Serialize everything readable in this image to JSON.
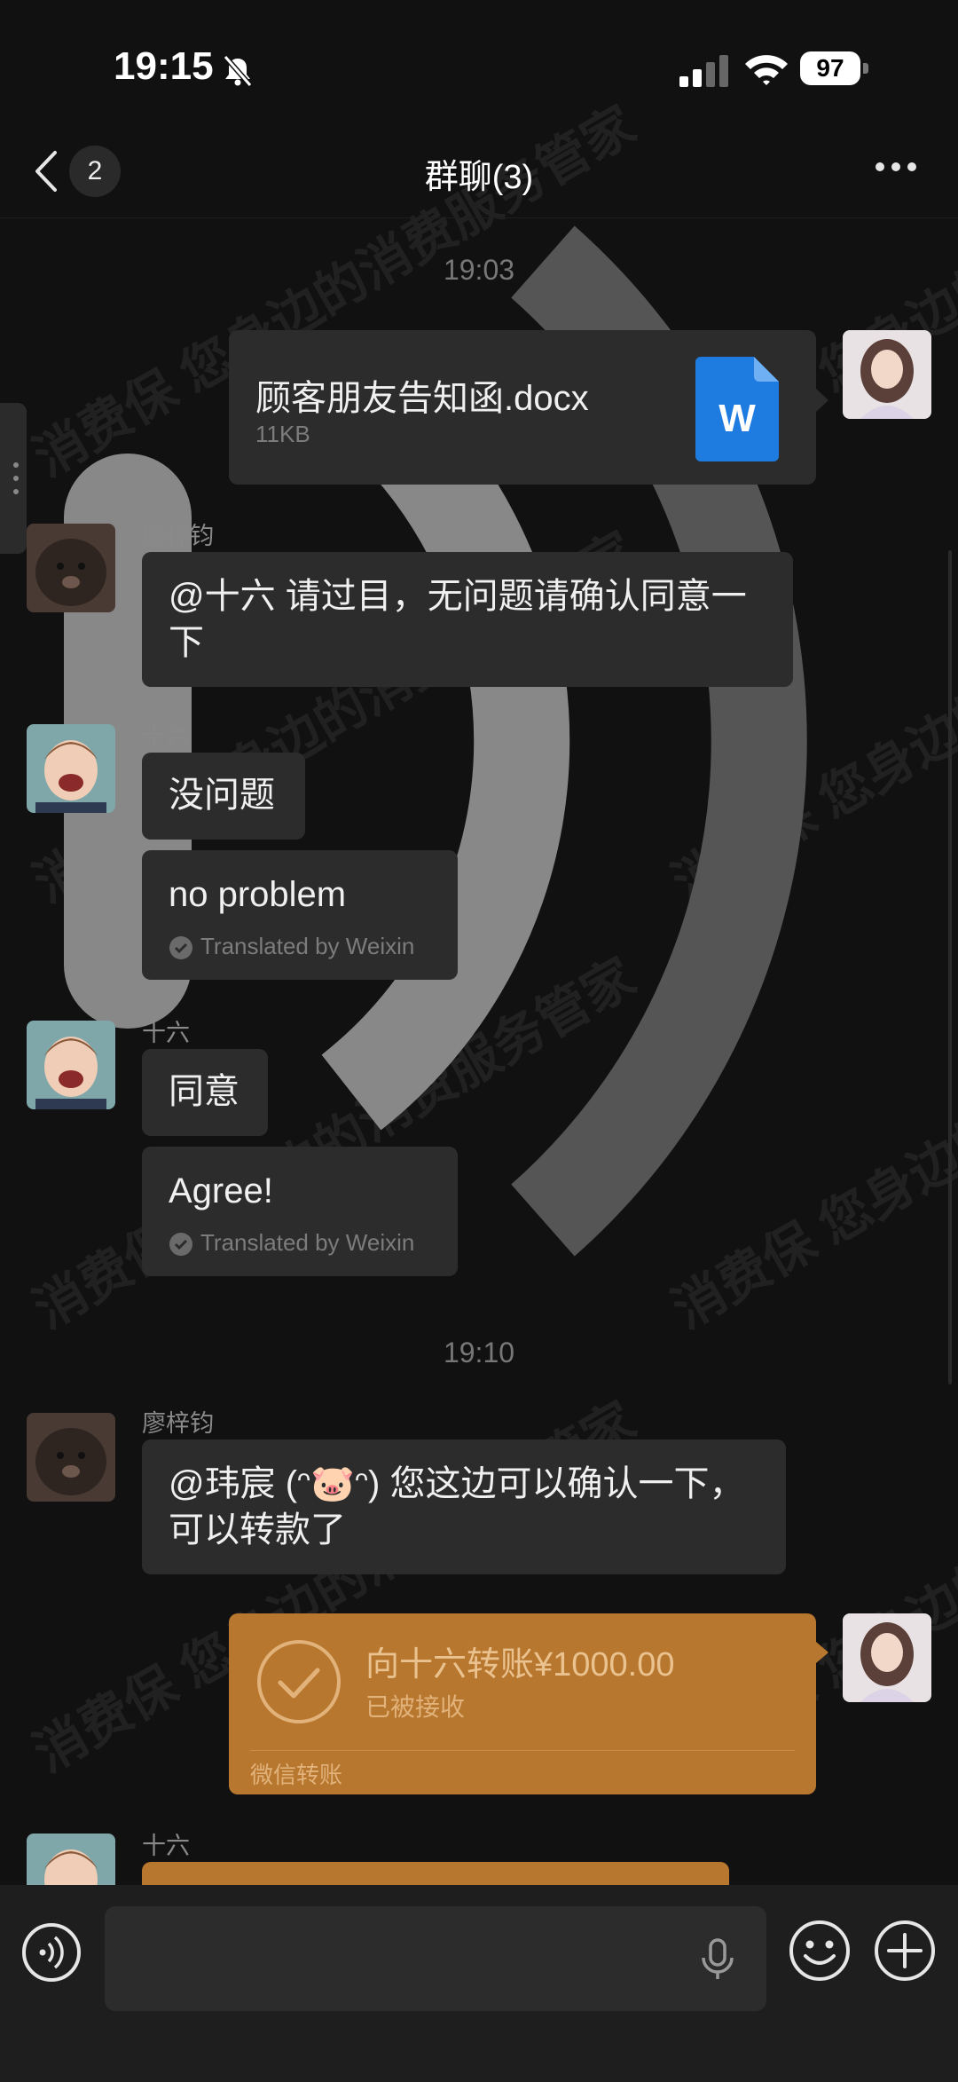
{
  "status_bar": {
    "time": "19:15",
    "battery": "97"
  },
  "nav": {
    "back_count": "2",
    "title": "群聊(3)"
  },
  "timestamps": [
    "19:03",
    "19:10"
  ],
  "messages": {
    "file": {
      "name": "顾客朋友告知函.docx",
      "size": "11KB",
      "icon_letter": "W"
    },
    "m1": {
      "sender": "廖梓钧",
      "text_line1": "@十六 请过目，无问题请确认同意一",
      "text_line2": "下"
    },
    "m2": {
      "sender": "十六",
      "text": "没问题",
      "translation": "no problem",
      "translated_by": "Translated by Weixin"
    },
    "m3": {
      "sender": "十六",
      "text": "同意",
      "translation": "Agree!",
      "translated_by": "Translated by Weixin"
    },
    "m4": {
      "sender": "廖梓钧",
      "text_line1": "@玮宸 (ᵔ🐷ᵔ) 您这边可以确认一下，",
      "text_line2": "可以转款了"
    },
    "transfer": {
      "amount": "向十六转账¥1000.00",
      "status": "已被接收",
      "label": "微信转账"
    },
    "m5": {
      "sender": "十六"
    }
  },
  "watermark": "消费保 您身边的消费服务管家",
  "colors": {
    "background": "#111111",
    "bubble": "#2c2c2c",
    "transfer": "#b8772e",
    "word_blue": "#1e7be0"
  }
}
